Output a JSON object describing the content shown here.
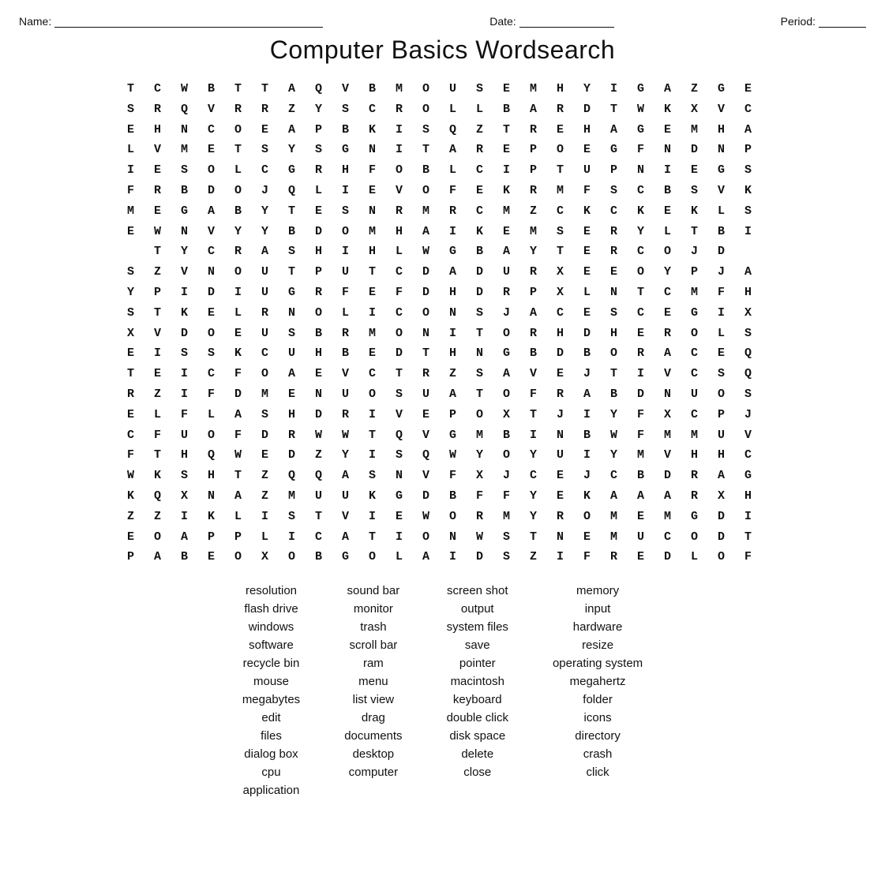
{
  "header": {
    "name_label": "Name:",
    "date_label": "Date:",
    "period_label": "Period:"
  },
  "title": "Computer Basics Wordsearch",
  "grid": [
    "T C W B T T A Q V B M O U S E M H Y I G A Z G E",
    "S R Q V R R Z Y S C R O L L B A R D T W K X V C",
    "E H N C O E A P B K I S Q Z T R E H A G E M H A",
    "L V M E T S Y S G N I T A R E P O E G F N D N P",
    "I E S O L C G R H F O B L C I P T U P N I E G S",
    "F R B D O J Q L I E V O F E K R M F S C B S V K",
    "M E G A B Y T E S N R M R C M Z C K C K E K L S",
    "E W N V Y Y B D O M H A I K E M S E R Y L T B I",
    "T Y C R A S H I H L W G B A Y T E R C O J D",
    "S Z V N O U T P U T C D A D U R X E E O Y P J A",
    "Y P I D I U G R F E F D H D R P X L N T C M F H",
    "S T K E L R N O L I C O N S J A C E S C E G I X",
    "X V D O E U S B R M O N I T O R H D H E R O L S",
    "E I S S K C U H B E D T H N G B D B O R A C E Q",
    "T E I C F O A E V C T R Z S A V E J T I V C S Q",
    "R Z I F D M E N U O S U A T O F R A B D N U O S",
    "E L F L A S H D R I V E P O X T J I Y F X C P J",
    "C F U O F D R W W T Q V G M B I N B W F M M U V",
    "F T H Q W E D Z Y I S Q W Y O Y U I Y M V H H C",
    "W K S H T Z Q Q A S N V F X J C E J C B D R A G",
    "K Q X N A Z M U U K G D B F F Y E K A A A R X H",
    "Z Z I K L I S T V I E W O R M Y R O M E M G D I",
    "E O A P P L I C A T I O N W S T N E M U C O D T",
    "P A B E O X O B G O L A I D S Z I F R E D L O F"
  ],
  "word_list": [
    [
      "resolution",
      "sound bar",
      "screen shot",
      "memory"
    ],
    [
      "flash drive",
      "monitor",
      "output",
      "input"
    ],
    [
      "windows",
      "trash",
      "system files",
      "hardware"
    ],
    [
      "software",
      "scroll bar",
      "save",
      "resize"
    ],
    [
      "recycle bin",
      "ram",
      "pointer",
      "operating system"
    ],
    [
      "mouse",
      "menu",
      "macintosh",
      "megahertz"
    ],
    [
      "megabytes",
      "list view",
      "keyboard",
      "folder"
    ],
    [
      "edit",
      "drag",
      "double click",
      "icons"
    ],
    [
      "files",
      "documents",
      "disk space",
      "directory"
    ],
    [
      "dialog box",
      "desktop",
      "delete",
      "crash"
    ],
    [
      "cpu",
      "computer",
      "close",
      "click"
    ],
    [
      "application",
      "",
      "",
      ""
    ]
  ]
}
